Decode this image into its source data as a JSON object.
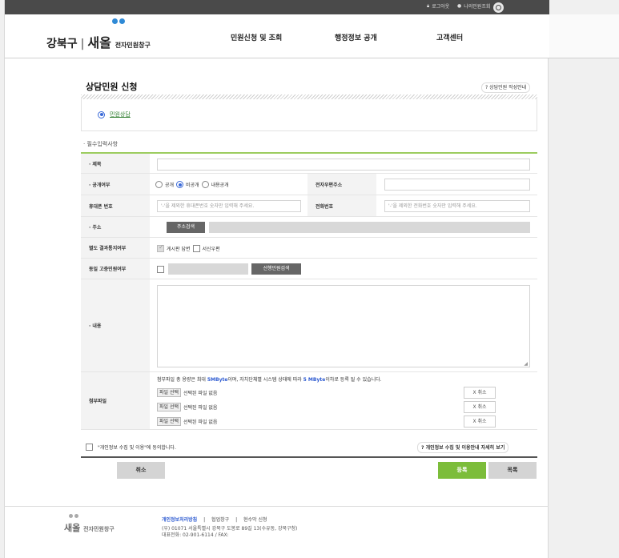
{
  "top_util": {
    "logout": "로그아웃",
    "my_petition": "나의민원조회"
  },
  "header": {
    "district": "강북구",
    "sep": "|",
    "brand": "새올",
    "brand_sub": "전자민원창구",
    "nav": [
      "민원신청 및 조회",
      "행정정보 공개",
      "고객센터"
    ]
  },
  "page": {
    "title": "상담민원 신청",
    "help": "? 상담민원 작성안내",
    "type_option": "민원상담",
    "section_label": "· 필수입력사항"
  },
  "form": {
    "subject_label": "· 제목",
    "disclosure_label": "· 공개여부",
    "disclosure_options": [
      "공개",
      "비공개",
      "내용공개"
    ],
    "email_label": "전자우편주소",
    "mobile_label": "휴대폰 번호",
    "mobile_placeholder": "'-'을 제외한 휴대폰번호 숫자만 입력해 주세요.",
    "phone_label": "전화번호",
    "phone_placeholder": "'-'을 제외한 전화번호 숫자만 입력해 주세요.",
    "address_label": "· 주소",
    "address_button": "주소검색",
    "notify_label": "별도 결과통지여부",
    "notify_options": [
      "게시판 답변",
      "서신우편"
    ],
    "repeat_label": "동일 고충민원여부",
    "repeat_button": "선행민원검색",
    "content_label": "· 내용",
    "attach_label": "첨부파일",
    "attach_note_prefix": "첨부파일 총 용량은 최대 ",
    "attach_size_1": "5MByte",
    "attach_note_mid": "이며, 자치단체별 시스템 상태에 따라 ",
    "attach_size_2": "5 MByte",
    "attach_note_suffix": "이하로 등록 될 수 있습니다.",
    "file_button": "파일 선택",
    "file_none": "선택된 파일 없음",
    "file_cancel": "X 취소"
  },
  "agreement": {
    "text": "\"개인정보 수집 및 이용\"에 동의합니다.",
    "detail_button": "? 개인정보 수집 및 이용안내 자세히 보기"
  },
  "actions": {
    "cancel": "취소",
    "submit": "등록",
    "list": "목록"
  },
  "footer": {
    "brand": "새올",
    "brand_sub": "전자민원창구",
    "links": [
      "개인정보처리방침",
      "협업창구",
      "현수막 신청"
    ],
    "address": "(우) 01071 서울특별시 강북구 도봉로 89길 13(수유동, 강북구청)",
    "phone": "대표전화: 02-901-6114 / FAX:"
  },
  "colors": {
    "accent_green": "#7cbd3a",
    "link_blue": "#2e5bd1",
    "topbar": "#4a4a4a"
  }
}
